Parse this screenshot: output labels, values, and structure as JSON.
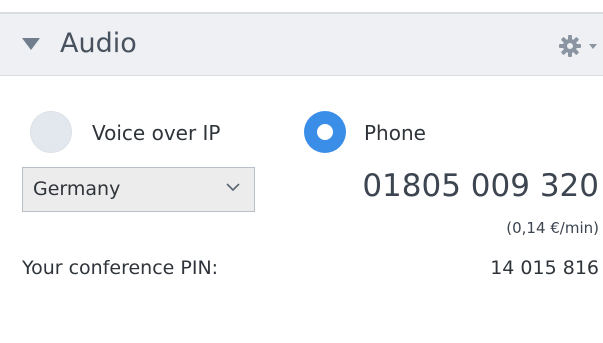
{
  "panel": {
    "title": "Audio",
    "icons": {
      "collapse": "triangle-down-icon",
      "settings": "gear-icon",
      "dropdown": "chevron-down-icon"
    }
  },
  "audio_options": [
    {
      "label": "Voice over IP",
      "selected": false
    },
    {
      "label": "Phone",
      "selected": true
    }
  ],
  "country": {
    "selected": "Germany"
  },
  "dial_in": {
    "number": "01805 009 320",
    "rate": "(0,14 €/min)"
  },
  "pin": {
    "label": "Your conference PIN:",
    "value": "14 015 816"
  },
  "colors": {
    "accent": "#3b8ee8",
    "header_bg": "#eef0f3",
    "text": "#2f343a"
  }
}
